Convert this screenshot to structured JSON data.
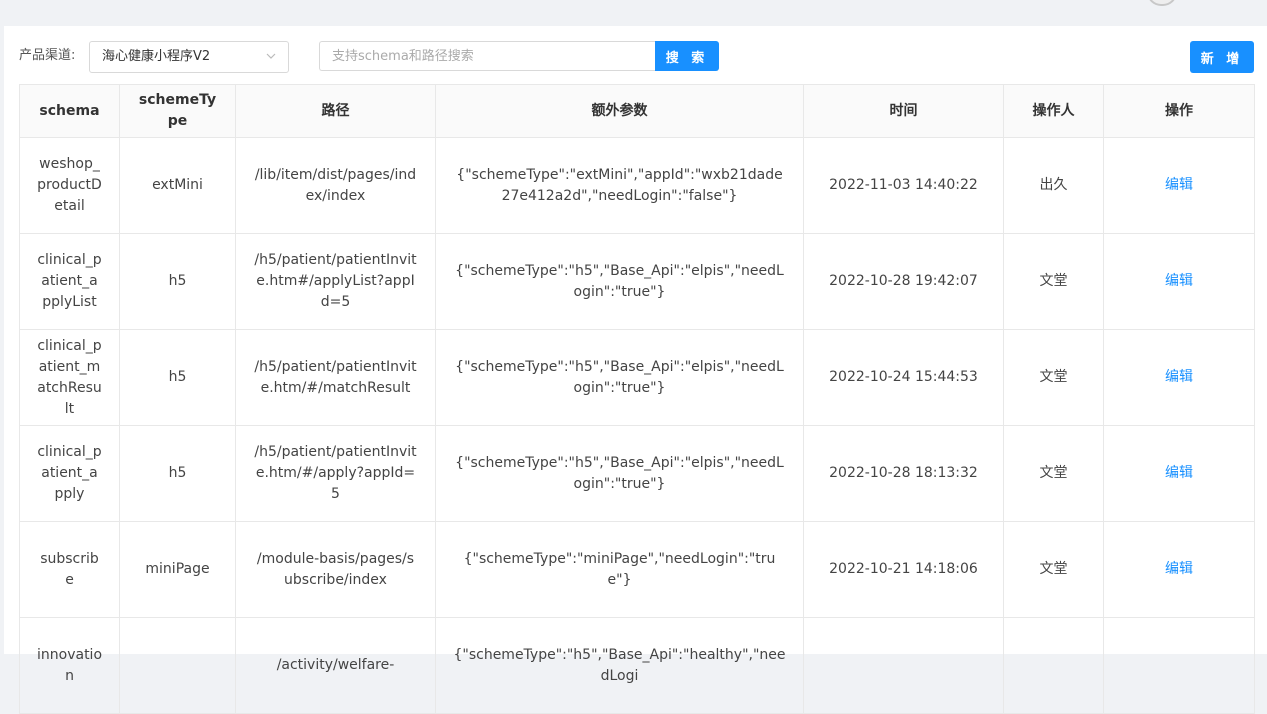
{
  "filter": {
    "channel_label": "产品渠道:",
    "channel_value": "海心健康小程序V2",
    "search_placeholder": "支持schema和路径搜索",
    "search_value": "",
    "search_button": "搜 索",
    "add_button": "新 增"
  },
  "table": {
    "headers": [
      "schema",
      "schemeType",
      "路径",
      "额外参数",
      "时间",
      "操作人",
      "操作"
    ],
    "rows": [
      {
        "schema": "weshop_productDetail",
        "type": "extMini",
        "path": "/lib/item/dist/pages/index/index",
        "params": "{\"schemeType\":\"extMini\",\"appId\":\"wxb21dade27e412a2d\",\"needLogin\":\"false\"}",
        "time": "2022-11-03 14:40:22",
        "operator": "出久",
        "action": "编辑"
      },
      {
        "schema": "clinical_patient_applyList",
        "type": "h5",
        "path": "/h5/patient/patientInvite.htm#/applyList?appId=5",
        "params": "{\"schemeType\":\"h5\",\"Base_Api\":\"elpis\",\"needLogin\":\"true\"}",
        "time": "2022-10-28 19:42:07",
        "operator": "文堂",
        "action": "编辑"
      },
      {
        "schema": "clinical_patient_matchResult",
        "type": "h5",
        "path": "/h5/patient/patientInvite.htm/#/matchResult",
        "params": "{\"schemeType\":\"h5\",\"Base_Api\":\"elpis\",\"needLogin\":\"true\"}",
        "time": "2022-10-24 15:44:53",
        "operator": "文堂",
        "action": "编辑"
      },
      {
        "schema": "clinical_patient_apply",
        "type": "h5",
        "path": "/h5/patient/patientInvite.htm/#/apply?appId=5",
        "params": "{\"schemeType\":\"h5\",\"Base_Api\":\"elpis\",\"needLogin\":\"true\"}",
        "time": "2022-10-28 18:13:32",
        "operator": "文堂",
        "action": "编辑"
      },
      {
        "schema": "subscribe",
        "type": "miniPage",
        "path": "/module-basis/pages/subscribe/index",
        "params": "{\"schemeType\":\"miniPage\",\"needLogin\":\"true\"}",
        "time": "2022-10-21 14:18:06",
        "operator": "文堂",
        "action": "编辑"
      },
      {
        "schema": "innovation",
        "type": "",
        "path": "/activity/welfare-",
        "params": "{\"schemeType\":\"h5\",\"Base_Api\":\"healthy\",\"needLogi",
        "time": "",
        "operator": "",
        "action": ""
      }
    ]
  },
  "colors": {
    "accent": "#1890ff",
    "background": "#f0f2f5",
    "header_bg": "#fafafa",
    "border": "#e8e8e8"
  }
}
